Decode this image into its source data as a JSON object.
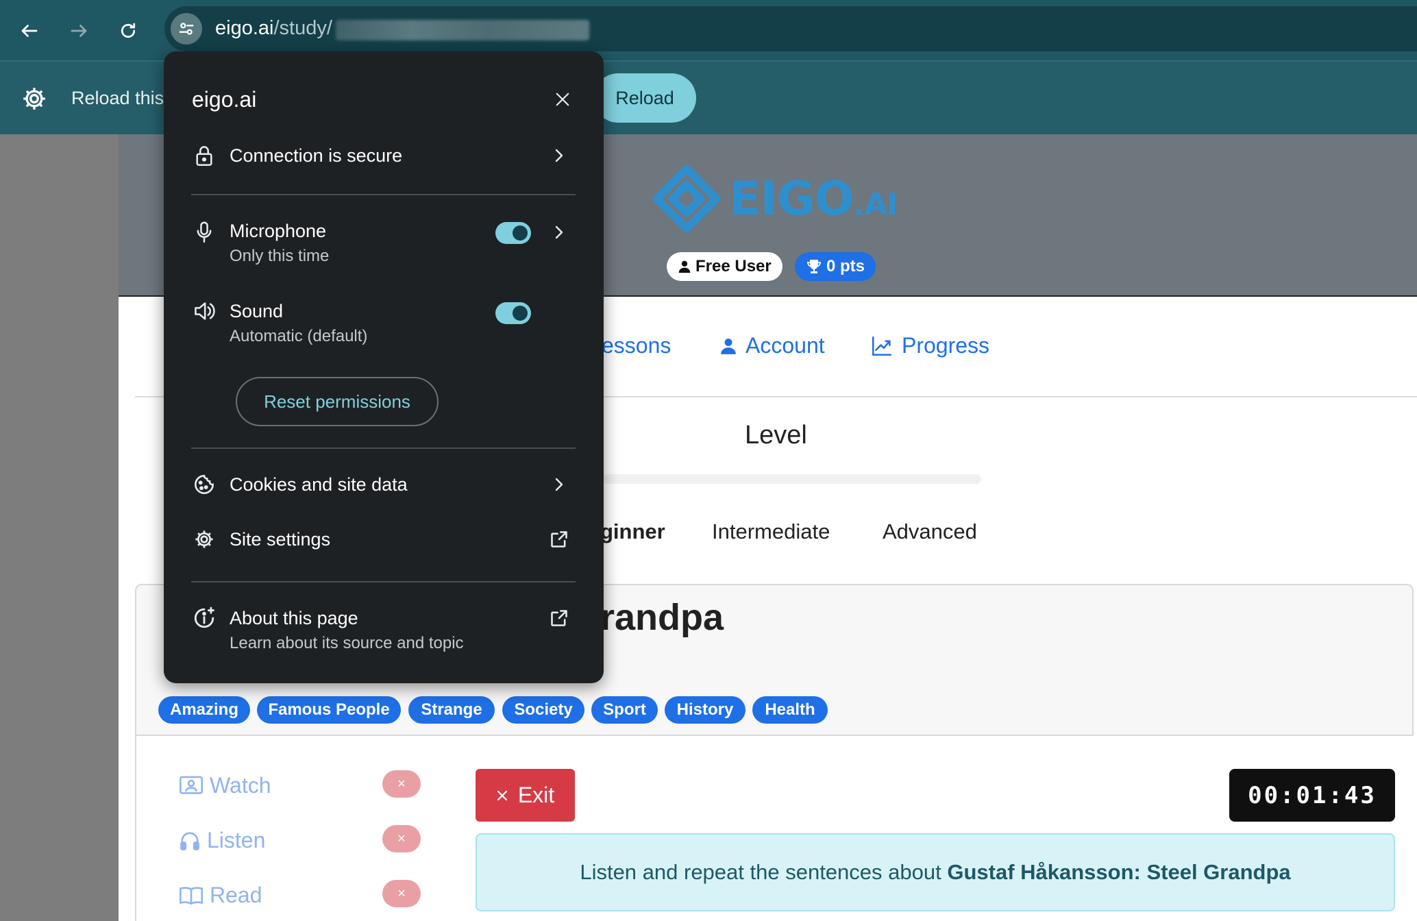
{
  "browser": {
    "url_host": "eigo.ai",
    "url_path": "/study/",
    "infobar_text": "Reload this",
    "reload_label": "Reload"
  },
  "site_info": {
    "host": "eigo.ai",
    "connection_label": "Connection is secure",
    "microphone_label": "Microphone",
    "microphone_sub": "Only this time",
    "microphone_enabled": true,
    "sound_label": "Sound",
    "sound_sub": "Automatic (default)",
    "sound_enabled": true,
    "reset_label": "Reset permissions",
    "cookies_label": "Cookies and site data",
    "site_settings_label": "Site settings",
    "about_label": "About this page",
    "about_sub": "Learn about its source and topic"
  },
  "page": {
    "logo_main": "EIGO",
    "logo_suffix": ".AI",
    "user_badge": "Free User",
    "points_badge": "0 pts",
    "nav": {
      "lessons": "essons",
      "account": "Account",
      "progress": "Progress"
    },
    "level_title": "Level",
    "levels": {
      "beginner": "ginner",
      "intermediate": "Intermediate",
      "advanced": "Advanced"
    },
    "lesson_title_visible": "randpa",
    "tags": [
      "Amazing",
      "Famous People",
      "Strange",
      "Society",
      "Sport",
      "History",
      "Health"
    ],
    "sidebar": {
      "watch": "Watch",
      "listen": "Listen",
      "read": "Read",
      "badge": "×"
    },
    "exit_label": "Exit",
    "timer": "00:01:43",
    "instruction_prefix": "Listen and repeat the sentences about ",
    "instruction_topic": "Gustaf Håkansson: Steel Grandpa"
  },
  "colors": {
    "chrome_toolbar": "#1f5763",
    "infobar": "#255d69",
    "accent_cyan": "#7fd0dc",
    "popup_bg": "#1e2124",
    "brand_blue": "#1f6fe6",
    "exit_red": "#d63b45"
  }
}
